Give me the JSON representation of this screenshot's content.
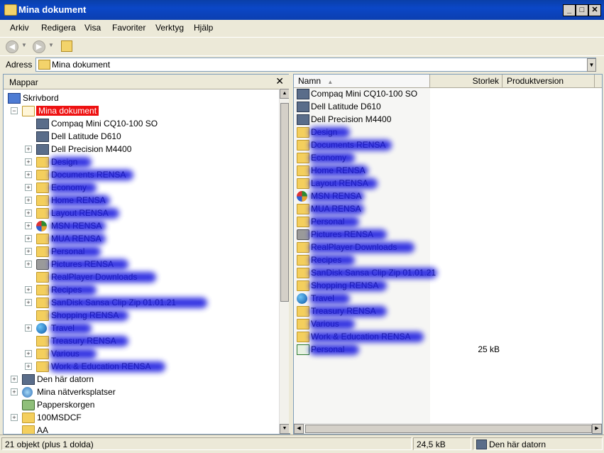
{
  "window": {
    "title": "Mina dokument",
    "btn_min": "_",
    "btn_max": "□",
    "btn_close": "✕"
  },
  "menu": [
    "Arkiv",
    "Redigera",
    "Visa",
    "Favoriter",
    "Verktyg",
    "Hjälp"
  ],
  "address": {
    "label": "Adress",
    "value": "Mina dokument"
  },
  "folders_pane": {
    "title": "Mappar",
    "close": "✕"
  },
  "tree": {
    "root": "Skrivbord",
    "selected": "Mina dokument",
    "children": [
      {
        "label": "Compaq Mini CQ10-100 SO",
        "icon": "computer-icon",
        "expand": false
      },
      {
        "label": "Dell Latitude D610",
        "icon": "computer-icon",
        "expand": false
      },
      {
        "label": "Dell Precision M4400",
        "icon": "computer-icon",
        "expand": true
      },
      {
        "label": "Design",
        "icon": "folder-icon",
        "expand": true,
        "obscured": true
      },
      {
        "label": "Documents RENSA",
        "icon": "folder-icon",
        "expand": true,
        "obscured": true
      },
      {
        "label": "Economy",
        "icon": "folder-icon",
        "expand": true,
        "obscured": true
      },
      {
        "label": "Home RENSA",
        "icon": "folder-icon",
        "expand": true,
        "obscured": true
      },
      {
        "label": "Layout RENSA",
        "icon": "folder-icon",
        "expand": true,
        "obscured": true
      },
      {
        "label": "MSN RENSA",
        "icon": "msn-icon",
        "expand": true,
        "obscured": true
      },
      {
        "label": "MUA RENSA",
        "icon": "folder-icon",
        "expand": true,
        "obscured": true
      },
      {
        "label": "Personal",
        "icon": "folder-icon",
        "expand": true,
        "obscured": true
      },
      {
        "label": "Pictures RENSA",
        "icon": "camera-icon",
        "expand": true,
        "obscured": true
      },
      {
        "label": "RealPlayer Downloads",
        "icon": "folder-icon",
        "expand": false,
        "obscured": true
      },
      {
        "label": "Recipes",
        "icon": "folder-icon",
        "expand": true,
        "obscured": true
      },
      {
        "label": "SanDisk Sansa Clip Zip 01.01.21",
        "icon": "folder-icon",
        "expand": true,
        "obscured": true
      },
      {
        "label": "Shopping RENSA",
        "icon": "folder-icon",
        "expand": false,
        "obscured": true
      },
      {
        "label": "Travel",
        "icon": "globe-icon",
        "expand": true,
        "obscured": true
      },
      {
        "label": "Treasury RENSA",
        "icon": "folder-icon",
        "expand": false,
        "obscured": true
      },
      {
        "label": "Various",
        "icon": "folder-icon",
        "expand": true,
        "obscured": true
      },
      {
        "label": "Work & Education RENSA",
        "icon": "folder-icon",
        "expand": true,
        "obscured": true
      }
    ],
    "bottom": [
      {
        "label": "Den här datorn",
        "icon": "computer-icon",
        "expand": true
      },
      {
        "label": "Mina nätverksplatser",
        "icon": "network-icon",
        "expand": true
      },
      {
        "label": "Papperskorgen",
        "icon": "recycle-bin-icon",
        "expand": false
      },
      {
        "label": "100MSDCF",
        "icon": "folder-icon",
        "expand": true
      },
      {
        "label": "AA",
        "icon": "folder-icon",
        "expand": false
      }
    ]
  },
  "columns": [
    "Namn",
    "Storlek",
    "Produktversion"
  ],
  "files": [
    {
      "name": "Compaq Mini CQ10-100 SO",
      "icon": "computer-icon",
      "size": ""
    },
    {
      "name": "Dell Latitude D610",
      "icon": "computer-icon",
      "size": ""
    },
    {
      "name": "Dell Precision M4400",
      "icon": "computer-icon",
      "size": ""
    },
    {
      "name": "Design",
      "icon": "folder-icon",
      "size": "",
      "obscured": true
    },
    {
      "name": "Documents RENSA",
      "icon": "folder-icon",
      "size": "",
      "obscured": true
    },
    {
      "name": "Economy",
      "icon": "folder-icon",
      "size": "",
      "obscured": true
    },
    {
      "name": "Home RENSA",
      "icon": "folder-icon",
      "size": "",
      "obscured": true
    },
    {
      "name": "Layout RENSA",
      "icon": "folder-icon",
      "size": "",
      "obscured": true
    },
    {
      "name": "MSN RENSA",
      "icon": "msn-icon",
      "size": "",
      "obscured": true
    },
    {
      "name": "MUA RENSA",
      "icon": "folder-icon",
      "size": "",
      "obscured": true
    },
    {
      "name": "Personal",
      "icon": "folder-icon",
      "size": "",
      "obscured": true
    },
    {
      "name": "Pictures RENSA",
      "icon": "camera-icon",
      "size": "",
      "obscured": true
    },
    {
      "name": "RealPlayer Downloads",
      "icon": "folder-icon",
      "size": "",
      "obscured": true
    },
    {
      "name": "Recipes",
      "icon": "folder-icon",
      "size": "",
      "obscured": true
    },
    {
      "name": "SanDisk Sansa Clip Zip 01.01.21",
      "icon": "folder-icon",
      "size": "",
      "obscured": true
    },
    {
      "name": "Shopping RENSA",
      "icon": "folder-icon",
      "size": "",
      "obscured": true
    },
    {
      "name": "Travel",
      "icon": "globe-icon",
      "size": "",
      "obscured": true
    },
    {
      "name": "Treasury RENSA",
      "icon": "folder-icon",
      "size": "",
      "obscured": true
    },
    {
      "name": "Various",
      "icon": "folder-icon",
      "size": "",
      "obscured": true
    },
    {
      "name": "Work & Education RENSA",
      "icon": "folder-icon",
      "size": "",
      "obscured": true
    },
    {
      "name": "Personal",
      "icon": "excel-file-icon",
      "size": "25 kB",
      "obscured": true
    }
  ],
  "status": {
    "objects": "21 objekt (plus 1 dolda)",
    "size": "24,5 kB",
    "location": "Den här datorn"
  }
}
